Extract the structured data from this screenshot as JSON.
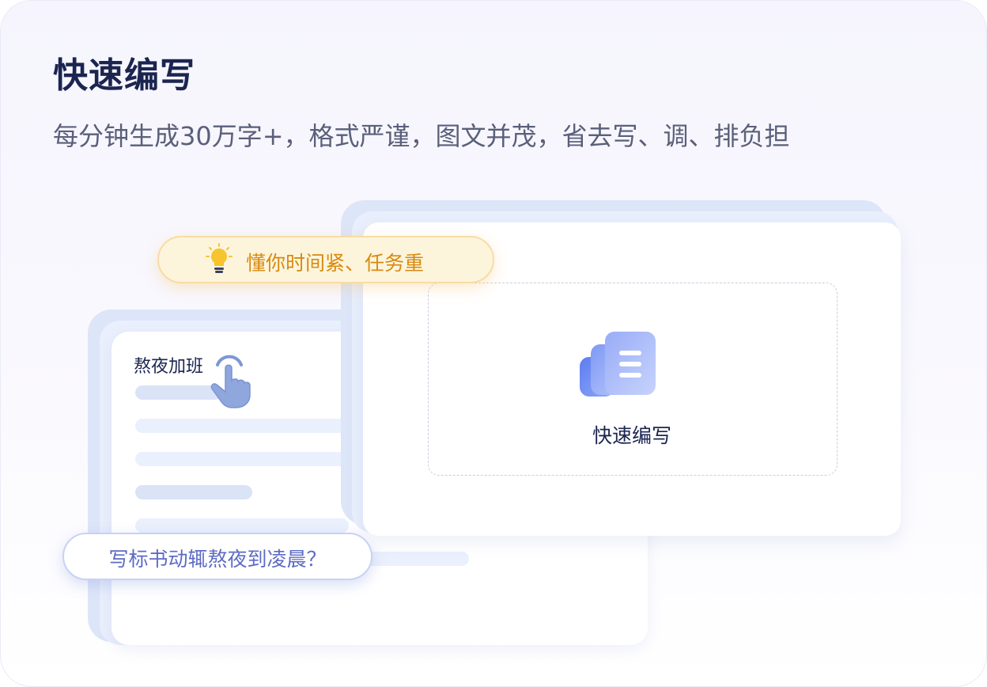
{
  "header": {
    "title": "快速编写",
    "subtitle": "每分钟生成30万字+，格式严谨，图文并茂，省去写、调、排负担"
  },
  "illustration": {
    "back_doc_title": "熬夜加班",
    "tip_badge": "懂你时间紧、任务重",
    "question_badge": "写标书动辄熬夜到凌晨？",
    "action_label": "快速编写"
  },
  "icons": {
    "bulb": "lightbulb-icon",
    "hand": "pointing-hand-icon",
    "document": "document-stack-icon"
  },
  "colors": {
    "title": "#1b2550",
    "subtitle": "#5a607a",
    "tip_text": "#d88a12",
    "question_text": "#5d6bc4",
    "accent_blue": "#7f99f2"
  }
}
